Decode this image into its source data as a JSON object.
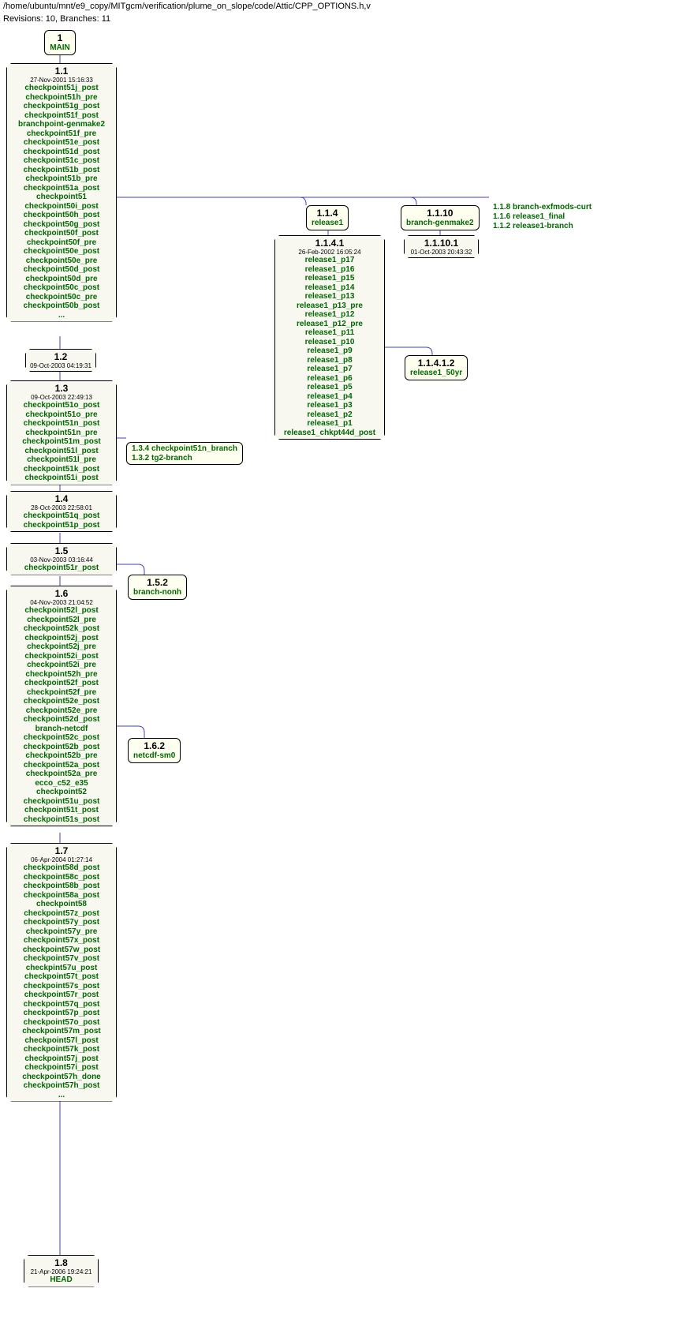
{
  "header": {
    "path": "/home/ubuntu/mnt/e9_copy/MITgcm/verification/plume_on_slope/code/Attic/CPP_OPTIONS.h,v",
    "revinfo": "Revisions: 10, Branches: 11"
  },
  "root": {
    "version": "1",
    "label": "MAIN"
  },
  "r11": {
    "version": "1.1",
    "timestamp": "27-Nov-2001 15:16:33",
    "tags": [
      "checkpoint51j_post",
      "checkpoint51h_pre",
      "checkpoint51g_post",
      "checkpoint51f_post",
      "branchpoint-genmake2",
      "checkpoint51f_pre",
      "checkpoint51e_post",
      "checkpoint51d_post",
      "checkpoint51c_post",
      "checkpoint51b_post",
      "checkpoint51b_pre",
      "checkpoint51a_post",
      "checkpoint51",
      "checkpoint50i_post",
      "checkpoint50h_post",
      "checkpoint50g_post",
      "checkpoint50f_post",
      "checkpoint50f_pre",
      "checkpoint50e_post",
      "checkpoint50e_pre",
      "checkpoint50d_post",
      "checkpoint50d_pre",
      "checkpoint50c_post",
      "checkpoint50c_pre",
      "checkpoint50b_post"
    ],
    "ellipsis": "..."
  },
  "r114": {
    "version": "1.1.4",
    "label": "release1"
  },
  "r1110": {
    "version": "1.1.10",
    "label": "branch-genmake2"
  },
  "r118_list": {
    "lines": [
      "1.1.8 branch-exfmods-curt",
      "1.1.6 release1_final",
      "1.1.2 release1-branch"
    ]
  },
  "r1141": {
    "version": "1.1.4.1",
    "timestamp": "26-Feb-2002 16:05:24",
    "tags": [
      "release1_p17",
      "release1_p16",
      "release1_p15",
      "release1_p14",
      "release1_p13",
      "release1_p13_pre",
      "release1_p12",
      "release1_p12_pre",
      "release1_p11",
      "release1_p10",
      "release1_p9",
      "release1_p8",
      "release1_p7",
      "release1_p6",
      "release1_p5",
      "release1_p4",
      "release1_p3",
      "release1_p2",
      "release1_p1",
      "release1_chkpt44d_post"
    ]
  },
  "r11412": {
    "version": "1.1.4.1.2",
    "label": "release1_50yr"
  },
  "r11101": {
    "version": "1.1.10.1",
    "timestamp": "01-Oct-2003 20:43:32"
  },
  "r12": {
    "version": "1.2",
    "timestamp": "09-Oct-2003 04:19:31"
  },
  "r13": {
    "version": "1.3",
    "timestamp": "09-Oct-2003 22:49:13",
    "tags": [
      "checkpoint51o_post",
      "checkpoint51o_pre",
      "checkpoint51n_post",
      "checkpoint51n_pre",
      "checkpoint51m_post",
      "checkpoint51l_post",
      "checkpoint51l_pre",
      "checkpoint51k_post",
      "checkpoint51i_post"
    ]
  },
  "r13_branches": {
    "lines": [
      "1.3.4 checkpoint51n_branch",
      "1.3.2 tg2-branch"
    ]
  },
  "r14": {
    "version": "1.4",
    "timestamp": "28-Oct-2003 22:58:01",
    "tags": [
      "checkpoint51q_post",
      "checkpoint51p_post"
    ]
  },
  "r15": {
    "version": "1.5",
    "timestamp": "03-Nov-2003 03:16:44",
    "tags": [
      "checkpoint51r_post"
    ]
  },
  "r152": {
    "version": "1.5.2",
    "label": "branch-nonh"
  },
  "r16": {
    "version": "1.6",
    "timestamp": "04-Nov-2003 21:04:52",
    "tags": [
      "checkpoint52l_post",
      "checkpoint52l_pre",
      "checkpoint52k_post",
      "checkpoint52j_post",
      "checkpoint52j_pre",
      "checkpoint52i_post",
      "checkpoint52i_pre",
      "checkpoint52h_pre",
      "checkpoint52f_post",
      "checkpoint52f_pre",
      "checkpoint52e_post",
      "checkpoint52e_pre",
      "checkpoint52d_post",
      "branch-netcdf",
      "checkpoint52c_post",
      "checkpoint52b_post",
      "checkpoint52b_pre",
      "checkpoint52a_post",
      "checkpoint52a_pre",
      "ecco_c52_e35",
      "checkpoint52",
      "checkpoint51u_post",
      "checkpoint51t_post",
      "checkpoint51s_post"
    ]
  },
  "r162": {
    "version": "1.6.2",
    "label": "netcdf-sm0"
  },
  "r17": {
    "version": "1.7",
    "timestamp": "06-Apr-2004 01:27:14",
    "tags": [
      "checkpoint58d_post",
      "checkpoint58c_post",
      "checkpoint58b_post",
      "checkpoint58a_post",
      "checkpoint58",
      "checkpoint57z_post",
      "checkpoint57y_post",
      "checkpoint57y_pre",
      "checkpoint57x_post",
      "checkpoint57w_post",
      "checkpoint57v_post",
      "checkpint57u_post",
      "checkpoint57t_post",
      "checkpoint57s_post",
      "checkpoint57r_post",
      "checkpoint57q_post",
      "checkpoint57p_post",
      "checkpoint57o_post",
      "checkpoint57m_post",
      "checkpoint57l_post",
      "checkpoint57k_post",
      "checkpoint57j_post",
      "checkpoint57i_post",
      "checkpoint57h_done",
      "checkpoint57h_post"
    ],
    "ellipsis": "..."
  },
  "r18": {
    "version": "1.8",
    "timestamp": "21-Apr-2006 19:24:21",
    "tags": [
      "HEAD"
    ]
  }
}
